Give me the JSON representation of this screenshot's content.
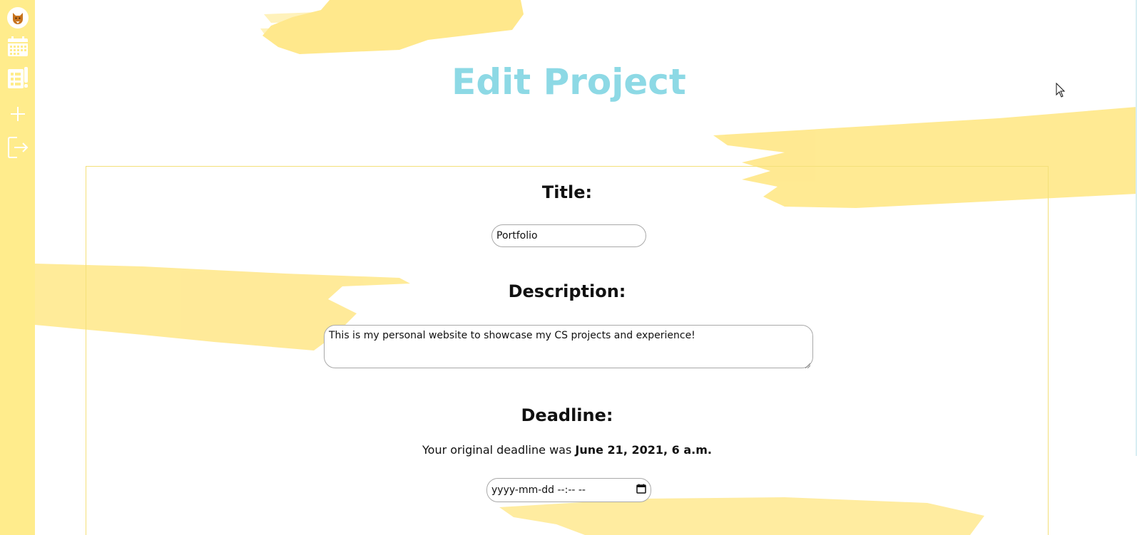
{
  "sidebar": {
    "items": [
      {
        "name": "logo",
        "icon": "fox-logo-icon"
      },
      {
        "name": "calendar",
        "icon": "calendar-icon"
      },
      {
        "name": "projects",
        "icon": "projects-icon"
      },
      {
        "name": "add",
        "icon": "plus-icon"
      },
      {
        "name": "logout",
        "icon": "logout-icon"
      }
    ],
    "background": "#ffec8c"
  },
  "page": {
    "title": "Edit Project",
    "title_color": "#8dd9e5"
  },
  "form": {
    "title_label": "Title:",
    "title_value": "Portfolio",
    "description_label": "Description:",
    "description_value": "This is my personal website to showcase my CS projects and experience!",
    "deadline_label": "Deadline:",
    "deadline_note_prefix": "Your original deadline was ",
    "deadline_note_value": "June 21, 2021, 6 a.m.",
    "deadline_input_placeholder": "yyyy-mm-dd --:-- --"
  },
  "colors": {
    "accent": "#8dd9e5",
    "brush": "#ffe680",
    "panel_border": "#f4e07a"
  }
}
